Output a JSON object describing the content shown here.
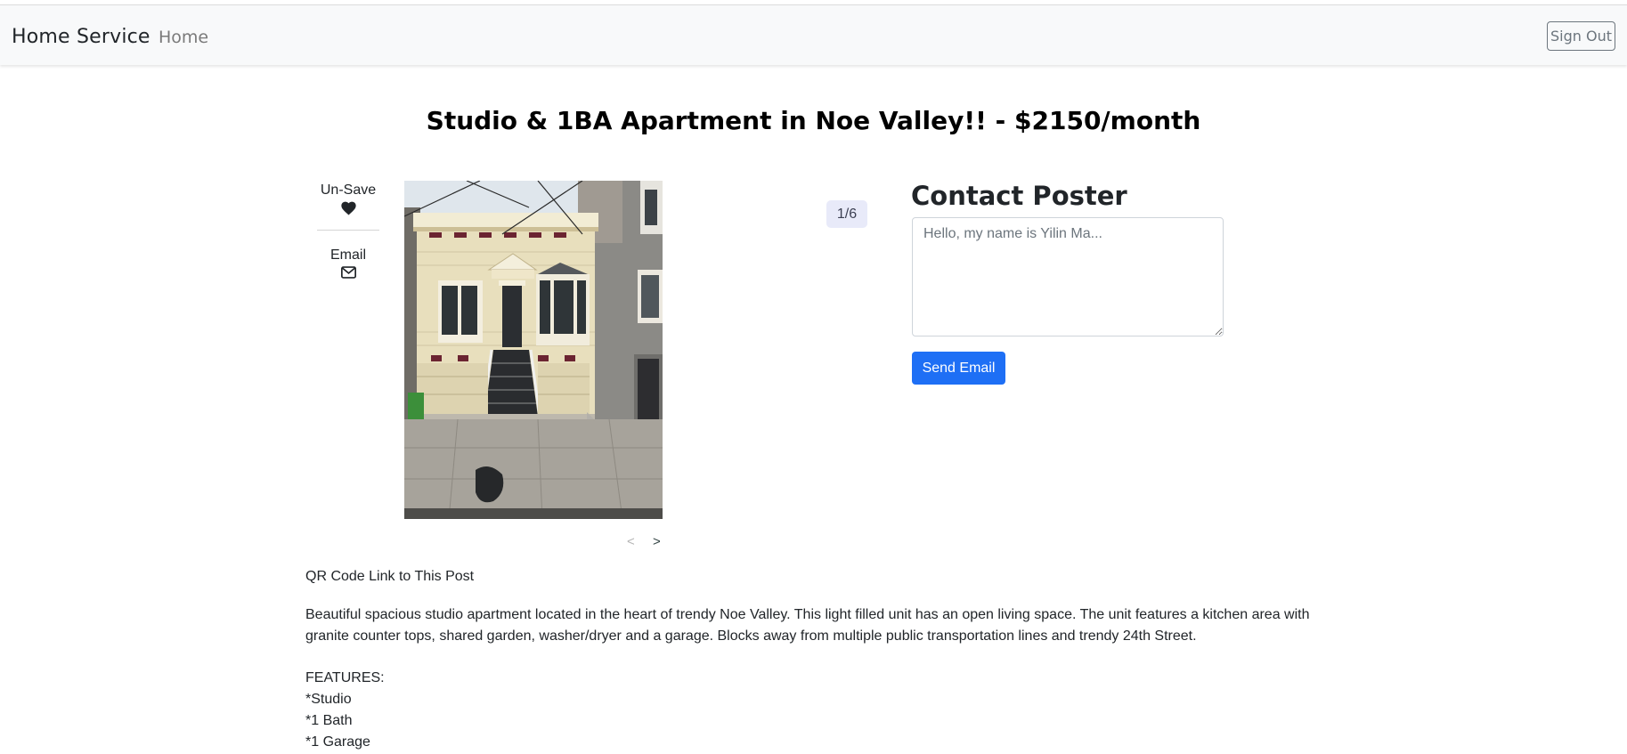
{
  "nav": {
    "brand": "Home Service",
    "home_link": "Home",
    "sign_out": "Sign Out"
  },
  "listing": {
    "title": "Studio & 1BA Apartment in Noe Valley!! - $2150/month",
    "save_label": "Un-Save",
    "email_label": "Email",
    "image_counter": "1/6",
    "prev": "<",
    "next": ">",
    "photo_alt": "Photo of a beige Victorian house with garage doors and front stairs",
    "qr_label": "QR Code Link to This Post",
    "description": "Beautiful spacious studio apartment located in the heart of trendy Noe Valley. This light filled unit has an open living space. The unit features a kitchen area with granite counter tops, shared garden, washer/dryer and a garage. Blocks away from multiple public transportation lines and trendy 24th Street.",
    "features_heading": "FEATURES:",
    "features": [
      "*Studio",
      "*1 Bath",
      "*1 Garage"
    ]
  },
  "contact": {
    "heading": "Contact Poster",
    "placeholder": "Hello, my name is Yilin Ma...",
    "send_label": "Send Email"
  },
  "colors": {
    "navbar_bg": "#f8f9fa",
    "primary": "#1e6ff5",
    "counter_bg": "#e8eaf9"
  }
}
